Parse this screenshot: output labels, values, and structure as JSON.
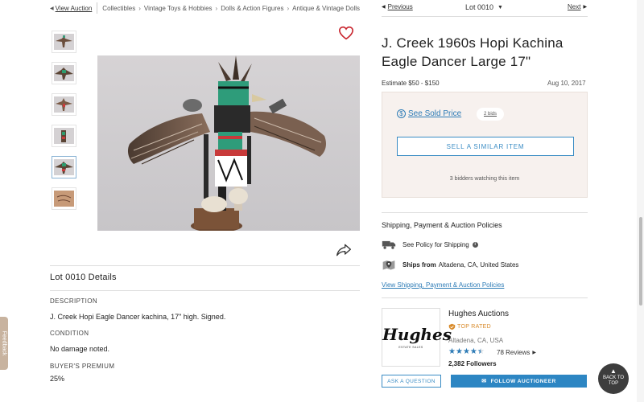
{
  "breadcrumb": {
    "view_auction": "View Auction",
    "items": [
      "Collectibles",
      "Vintage Toys & Hobbies",
      "Dolls & Action Figures",
      "Antique & Vintage Dolls"
    ]
  },
  "lot_nav": {
    "previous": "Previous",
    "lot_number": "Lot 0010",
    "next": "Next"
  },
  "item": {
    "title": "J. Creek 1960s Hopi Kachina Eagle Dancer Large 17\"",
    "estimate": "Estimate $50 - $150",
    "date": "Aug 10, 2017"
  },
  "bid_box": {
    "see_sold_price": "See Sold Price",
    "bids": "2 bids",
    "sell_button": "SELL A SIMILAR ITEM",
    "watching": "3 bidders watching this item"
  },
  "details": {
    "heading": "Lot 0010 Details",
    "sections": [
      {
        "label": "DESCRIPTION",
        "value": "J. Creek Hopi Eagle Dancer kachina, 17\" high. Signed."
      },
      {
        "label": "CONDITION",
        "value": "No damage noted."
      },
      {
        "label": "BUYER'S PREMIUM",
        "value": "25%"
      }
    ]
  },
  "shipping": {
    "heading": "Shipping, Payment & Auction Policies",
    "policy": "See Policy for Shipping",
    "ships_from_label": "Ships from",
    "ships_from_value": "Altadena, CA, United States",
    "link": "View Shipping, Payment & Auction Policies"
  },
  "auctioneer": {
    "logo_text": "Hughes",
    "logo_sub": "ESTATE SALES",
    "name": "Hughes Auctions",
    "badge": "TOP RATED",
    "location": "Altadena, CA, USA",
    "rating": 4.5,
    "reviews": "78 Reviews",
    "followers": "2,382 Followers",
    "ask_button": "ASK A QUESTION",
    "follow_button": "FOLLOW AUCTIONEER"
  },
  "feedback": "Feedback",
  "back_to_top": "BACK TO TOP",
  "colors": {
    "accent": "#2d7bb6",
    "heart": "#c8232c",
    "top_rated": "#d88a2a",
    "bid_box_bg": "#f7f1ee"
  }
}
